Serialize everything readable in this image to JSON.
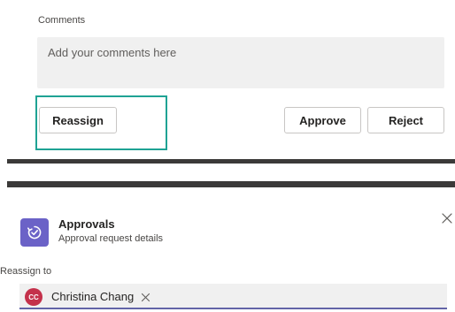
{
  "comments": {
    "label": "Comments",
    "placeholder": "Add your comments here"
  },
  "actions": {
    "reassign_label": "Reassign",
    "approve_label": "Approve",
    "reject_label": "Reject"
  },
  "highlight_color": "#1fa394",
  "card": {
    "app_icon": "approvals-icon",
    "app_icon_color": "#6b62c7",
    "title": "Approvals",
    "subtitle": "Approval request details",
    "close_icon": "close-icon"
  },
  "reassign": {
    "label": "Reassign to",
    "selected_person": {
      "initials": "CC",
      "name": "Christina Chang",
      "avatar_color": "#c4314b"
    },
    "remove_icon": "close-icon",
    "accent_color": "#6264a7"
  }
}
